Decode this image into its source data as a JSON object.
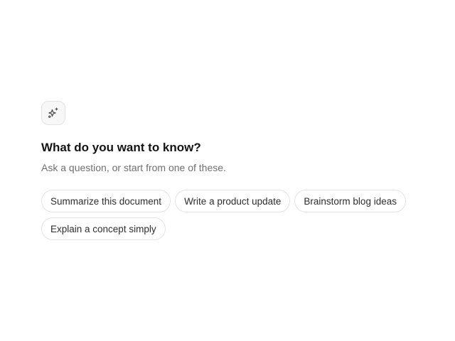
{
  "prompt": {
    "icon": "sparkles-icon",
    "title": "What do you want to know?",
    "subtitle": "Ask a question, or start from one of these.",
    "suggestions": [
      "Summarize this document",
      "Write a product update",
      "Brainstorm blog ideas",
      "Explain a concept simply"
    ]
  }
}
